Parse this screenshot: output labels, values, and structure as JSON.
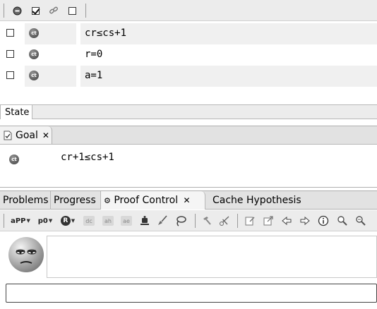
{
  "top_toolbar": {
    "icons": [
      "stop-circle-icon",
      "checked-checkbox-icon",
      "link-icon",
      "empty-checkbox-icon"
    ]
  },
  "hypotheses": [
    {
      "badge": "ct",
      "text": "cr≤cs+1",
      "checked": false
    },
    {
      "badge": "ct",
      "text": "r=0",
      "checked": false
    },
    {
      "badge": "ct",
      "text": "a=1",
      "checked": false
    }
  ],
  "state_tab": {
    "label": "State"
  },
  "goal_view": {
    "tab_label": "Goal",
    "badge": "ct",
    "formula": "cr+1≤cs+1"
  },
  "bottom_tabs": [
    {
      "label": "Problems",
      "active": false
    },
    {
      "label": "Progress",
      "active": false
    },
    {
      "label": "Proof Control",
      "active": true
    },
    {
      "label": "Cache Hypothesis",
      "active": false
    }
  ],
  "proof_control_toolbar": {
    "app_dropdown": "aPP",
    "p0_dropdown": "p0",
    "r_dropdown": "R",
    "mini_buttons": [
      "dc",
      "ah",
      "ae"
    ]
  },
  "command_input": {
    "value": ""
  },
  "message_area": {
    "text": ""
  }
}
